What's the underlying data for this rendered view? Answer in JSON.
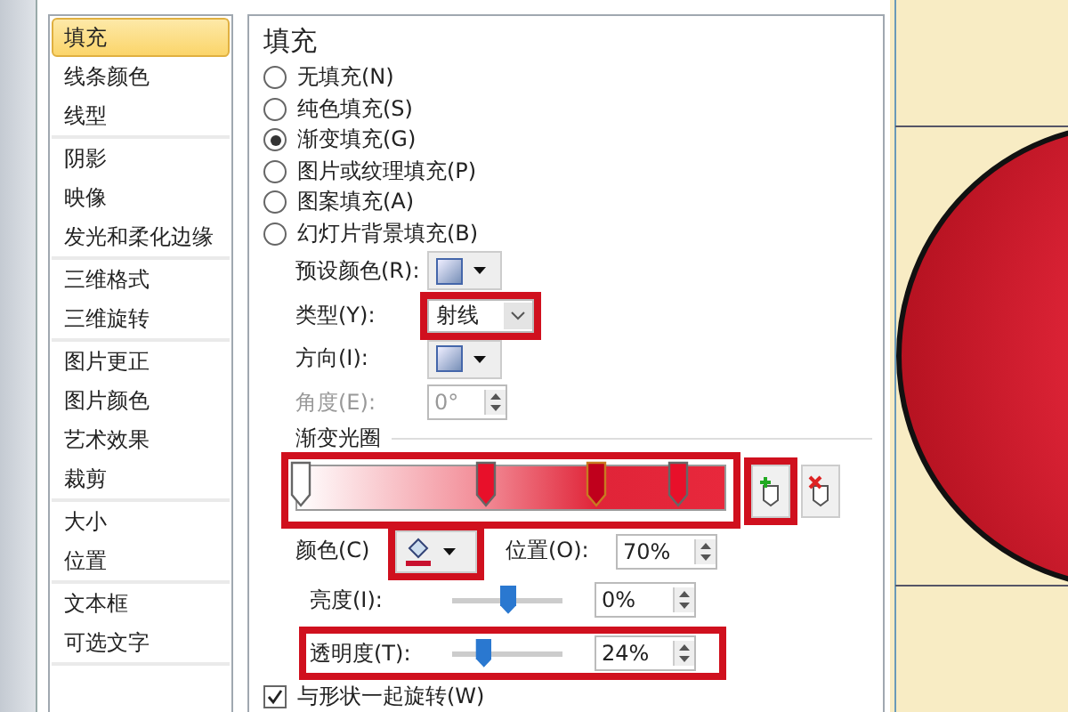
{
  "sidebar": {
    "groups": [
      [
        {
          "label": "填充",
          "selected": true
        },
        {
          "label": "线条颜色",
          "selected": false
        },
        {
          "label": "线型",
          "selected": false
        }
      ],
      [
        {
          "label": "阴影",
          "selected": false
        },
        {
          "label": "映像",
          "selected": false
        },
        {
          "label": "发光和柔化边缘",
          "selected": false
        }
      ],
      [
        {
          "label": "三维格式",
          "selected": false
        },
        {
          "label": "三维旋转",
          "selected": false
        }
      ],
      [
        {
          "label": "图片更正",
          "selected": false
        },
        {
          "label": "图片颜色",
          "selected": false
        },
        {
          "label": "艺术效果",
          "selected": false
        },
        {
          "label": "裁剪",
          "selected": false
        }
      ],
      [
        {
          "label": "大小",
          "selected": false
        },
        {
          "label": "位置",
          "selected": false
        }
      ],
      [
        {
          "label": "文本框",
          "selected": false
        },
        {
          "label": "可选文字",
          "selected": false
        }
      ]
    ]
  },
  "fill": {
    "title": "填充",
    "options": [
      {
        "label": "无填充(N)",
        "selected": false
      },
      {
        "label": "纯色填充(S)",
        "selected": false
      },
      {
        "label": "渐变填充(G)",
        "selected": true
      },
      {
        "label": "图片或纹理填充(P)",
        "selected": false
      },
      {
        "label": "图案填充(A)",
        "selected": false
      },
      {
        "label": "幻灯片背景填充(B)",
        "selected": false
      }
    ],
    "preset": {
      "label": "预设颜色(R):"
    },
    "type": {
      "label": "类型(Y):",
      "value": "射线",
      "highlighted": true
    },
    "direction": {
      "label": "方向(I):"
    },
    "angle": {
      "label": "角度(E):",
      "value": "0°",
      "disabled": true
    },
    "gradient": {
      "label": "渐变光圈",
      "highlighted": true,
      "add_highlighted": true,
      "stops": [
        {
          "level": 0.01,
          "color": "#ffffff",
          "selected": false
        },
        {
          "level": 0.44,
          "color": "#e8102a",
          "selected": false
        },
        {
          "level": 0.7,
          "color": "#c0001c",
          "selected": true
        },
        {
          "level": 0.89,
          "color": "#e8102a",
          "selected": false
        }
      ]
    },
    "color": {
      "label": "颜色(C)",
      "highlighted": true
    },
    "position": {
      "label": "位置(O):",
      "value": "70%"
    },
    "brightness": {
      "label": "亮度(I):",
      "level": 0.5,
      "value": "0%",
      "highlighted": false
    },
    "transparency": {
      "label": "透明度(T):",
      "level": 0.28,
      "value": "24%",
      "highlighted": true
    },
    "rotate": {
      "label": "与形状一起旋转(W)",
      "checked": true
    }
  }
}
